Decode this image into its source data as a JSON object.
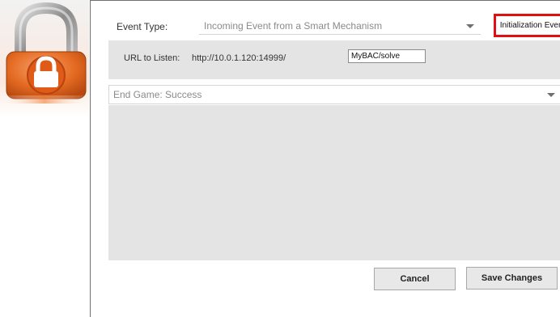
{
  "logo": {
    "icon": "padlock-icon"
  },
  "event": {
    "label": "Event Type:",
    "selected": "Incoming Event from a Smart Mechanism",
    "init_button_label": "Initialization Events",
    "highlight_color": "#e01010"
  },
  "url": {
    "label": "URL to Listen:",
    "value": "http://10.0.1.120:14999/",
    "path_value": "MyBAC/solve"
  },
  "end_game": {
    "selected": "End Game: Success"
  },
  "actions": {
    "cancel_label": "Cancel",
    "save_label": "Save Changes"
  }
}
